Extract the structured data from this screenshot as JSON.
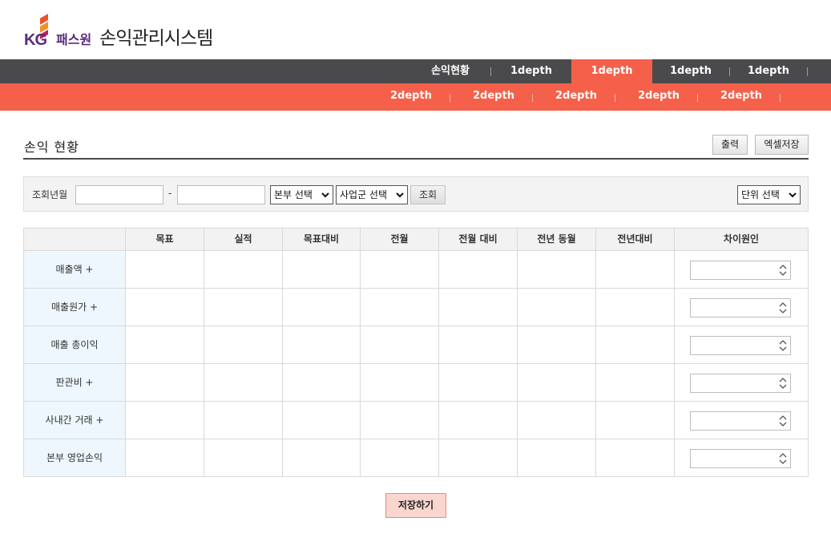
{
  "brand": {
    "logo_mark": "KG",
    "company": "패스원",
    "system_title": "손익관리시스템"
  },
  "nav1": {
    "items": [
      {
        "label": "손익현황",
        "active": false
      },
      {
        "label": "1depth",
        "active": false
      },
      {
        "label": "1depth",
        "active": true
      },
      {
        "label": "1depth",
        "active": false
      },
      {
        "label": "1depth",
        "active": false
      }
    ]
  },
  "nav2": {
    "items": [
      {
        "label": "2depth"
      },
      {
        "label": "2depth"
      },
      {
        "label": "2depth"
      },
      {
        "label": "2depth"
      },
      {
        "label": "2depth"
      }
    ]
  },
  "page": {
    "title": "손익 현황",
    "print_label": "출력",
    "excel_label": "엑셀저장"
  },
  "search": {
    "period_label": "조회년월",
    "from_value": "",
    "to_value": "",
    "dash": "-",
    "hq_select": "본부 선택",
    "biz_select": "사업군 선택",
    "search_button": "조회",
    "unit_select": "단위 선택"
  },
  "table": {
    "headers": [
      "",
      "목표",
      "실적",
      "목표대비",
      "전월",
      "전월 대비",
      "전년 동월",
      "전년대비",
      "차이원인"
    ],
    "rows": [
      {
        "label": "매출액 +"
      },
      {
        "label": "매출원가 +"
      },
      {
        "label": "매출 총이익"
      },
      {
        "label": "판관비 +"
      },
      {
        "label": "사내간 거래 +"
      },
      {
        "label": "본부 영업손익"
      }
    ]
  },
  "save_button": "저장하기",
  "colors": {
    "nav1_bg": "#4a4a4c",
    "accent": "#f5604a",
    "brand_purple": "#5b2d7a",
    "row_label_bg": "#eef7fd"
  }
}
